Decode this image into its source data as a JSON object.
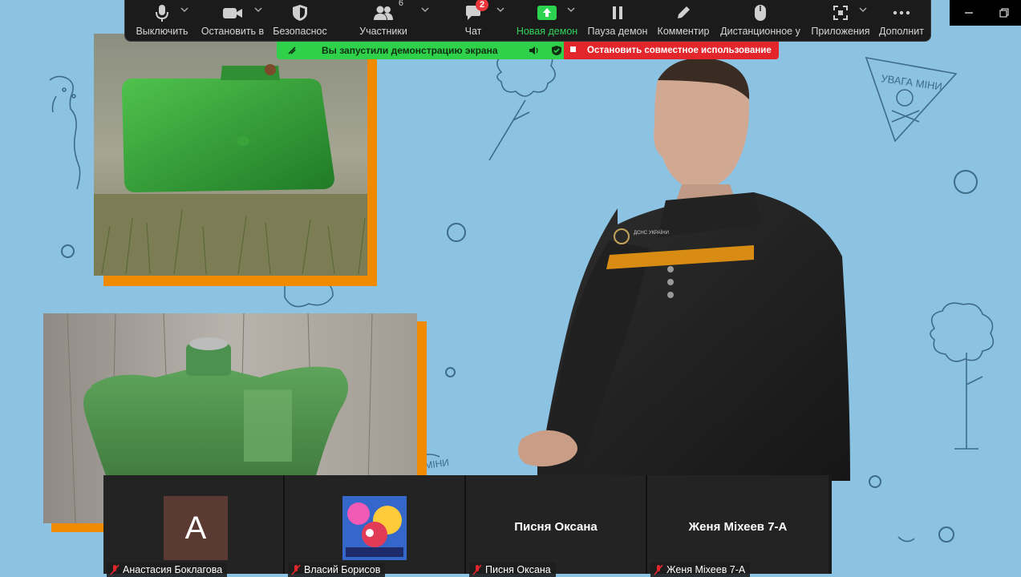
{
  "toolbar": {
    "items": [
      {
        "label": "Выключить",
        "icon": "microphone-icon"
      },
      {
        "label": "Остановить в",
        "icon": "video-camera-icon"
      },
      {
        "label": "Безопаснос",
        "icon": "shield-icon"
      },
      {
        "label": "Участники",
        "icon": "participants-icon",
        "count": "6"
      },
      {
        "label": "Чат",
        "icon": "chat-icon",
        "badge": "2"
      },
      {
        "label": "Новая демон",
        "icon": "share-screen-icon"
      },
      {
        "label": "Пауза демон",
        "icon": "pause-icon"
      },
      {
        "label": "Комментир",
        "icon": "pencil-icon"
      },
      {
        "label": "Дистанционное у",
        "icon": "mouse-icon"
      },
      {
        "label": "Приложения",
        "icon": "apps-icon"
      },
      {
        "label": "Дополнит",
        "icon": "more-icon"
      }
    ]
  },
  "share_banner": {
    "text": "Вы запустили демонстрацию экрана",
    "stop_label": "Остановить совместное использование"
  },
  "background": {
    "sign_text": "УВАГА МІНИ",
    "sign_text_2": "МІНИ"
  },
  "presenter": {
    "patch_text": "ДСНС УКРАЇНИ"
  },
  "gallery": {
    "tiles": [
      {
        "name": "Анастасия Боклагова",
        "avatar_letter": "А",
        "muted": true
      },
      {
        "name": "Власий Борисов",
        "avatar": "game-avatar",
        "muted": true
      },
      {
        "center_name": "Писня Оксана",
        "name": "Писня Оксана",
        "muted": true
      },
      {
        "center_name": "Женя Міхеев 7-А",
        "name": "Женя Міхеев 7-А",
        "muted": true
      }
    ]
  },
  "colors": {
    "background": "#8cc3e3",
    "accent_orange": "#f08a00",
    "share_green": "#2fd14a",
    "stop_red": "#e3262b",
    "toolbar": "#1b1b1c"
  }
}
